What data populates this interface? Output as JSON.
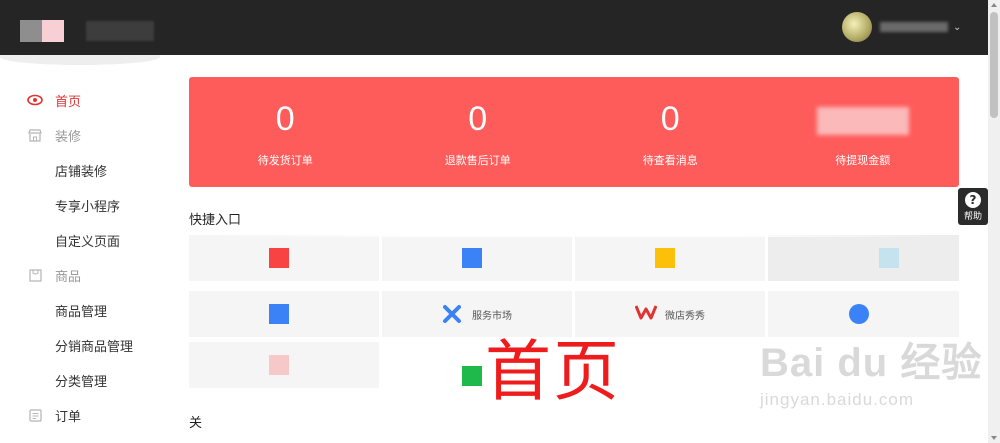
{
  "header": {
    "user_caret": "⌄"
  },
  "sidebar": {
    "items": [
      {
        "label": "首页",
        "icon": "eye-icon",
        "glyph": "👁",
        "type": "active"
      },
      {
        "label": "装修",
        "icon": "store-icon",
        "glyph": "⌂",
        "type": "group"
      },
      {
        "label": "店铺装修",
        "type": "sub"
      },
      {
        "label": "专享小程序",
        "type": "sub"
      },
      {
        "label": "自定义页面",
        "type": "sub"
      },
      {
        "label": "商品",
        "icon": "goods-icon",
        "glyph": "▢",
        "type": "group"
      },
      {
        "label": "商品管理",
        "type": "sub"
      },
      {
        "label": "分销商品管理",
        "type": "sub"
      },
      {
        "label": "分类管理",
        "type": "sub"
      },
      {
        "label": "订单",
        "icon": "order-icon",
        "glyph": "▤",
        "type": "plain"
      }
    ]
  },
  "stats": [
    {
      "value": "0",
      "label": "待发货订单"
    },
    {
      "value": "0",
      "label": "退款售后订单"
    },
    {
      "value": "0",
      "label": "待查看消息"
    },
    {
      "value": "",
      "label": "待提现金额"
    }
  ],
  "quick": {
    "title": "快捷入口",
    "tiles": [
      {
        "label": "",
        "color": "#f94343"
      },
      {
        "label": "",
        "color": "#3b82f6"
      },
      {
        "label": "",
        "color": "#fcbf0a"
      },
      {
        "label": "",
        "color": "#c5e3ef"
      },
      {
        "label": "",
        "color": "#3b82f6"
      },
      {
        "label": "服务市场",
        "color": "#3b82f6",
        "icon": "x-icon"
      },
      {
        "label": "微店秀秀",
        "color": "#e23333",
        "icon": "w-icon"
      },
      {
        "label": "",
        "color": "#3b82f6"
      },
      {
        "label": "",
        "color": "#f0a0a0"
      },
      {
        "label": "",
        "color": "#1fb84a"
      },
      {
        "label": "",
        "color": "#f94343"
      }
    ]
  },
  "related_title": "关",
  "overlay_title": "首页",
  "watermark": {
    "logo": "Bai du 经验",
    "url": "jingyan.baidu.com"
  },
  "help": {
    "label": "帮助",
    "glyph": "?"
  }
}
